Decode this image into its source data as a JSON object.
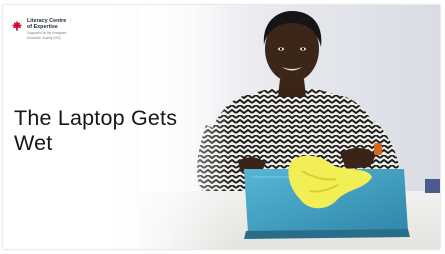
{
  "logo": {
    "icon": "maple-leaf-icon",
    "title_line1": "Literacy Centre",
    "title_line2": "of Expertise",
    "subtitle_line1": "Supported by the Immigrant",
    "subtitle_line2": "Education Society (ISS)"
  },
  "slide": {
    "title_line1": "The Laptop Gets",
    "title_line2": "Wet"
  },
  "colors": {
    "logo_red": "#c8102e",
    "laptop_blue": "#3fa0c4",
    "cloth_yellow": "#f2ee55"
  }
}
